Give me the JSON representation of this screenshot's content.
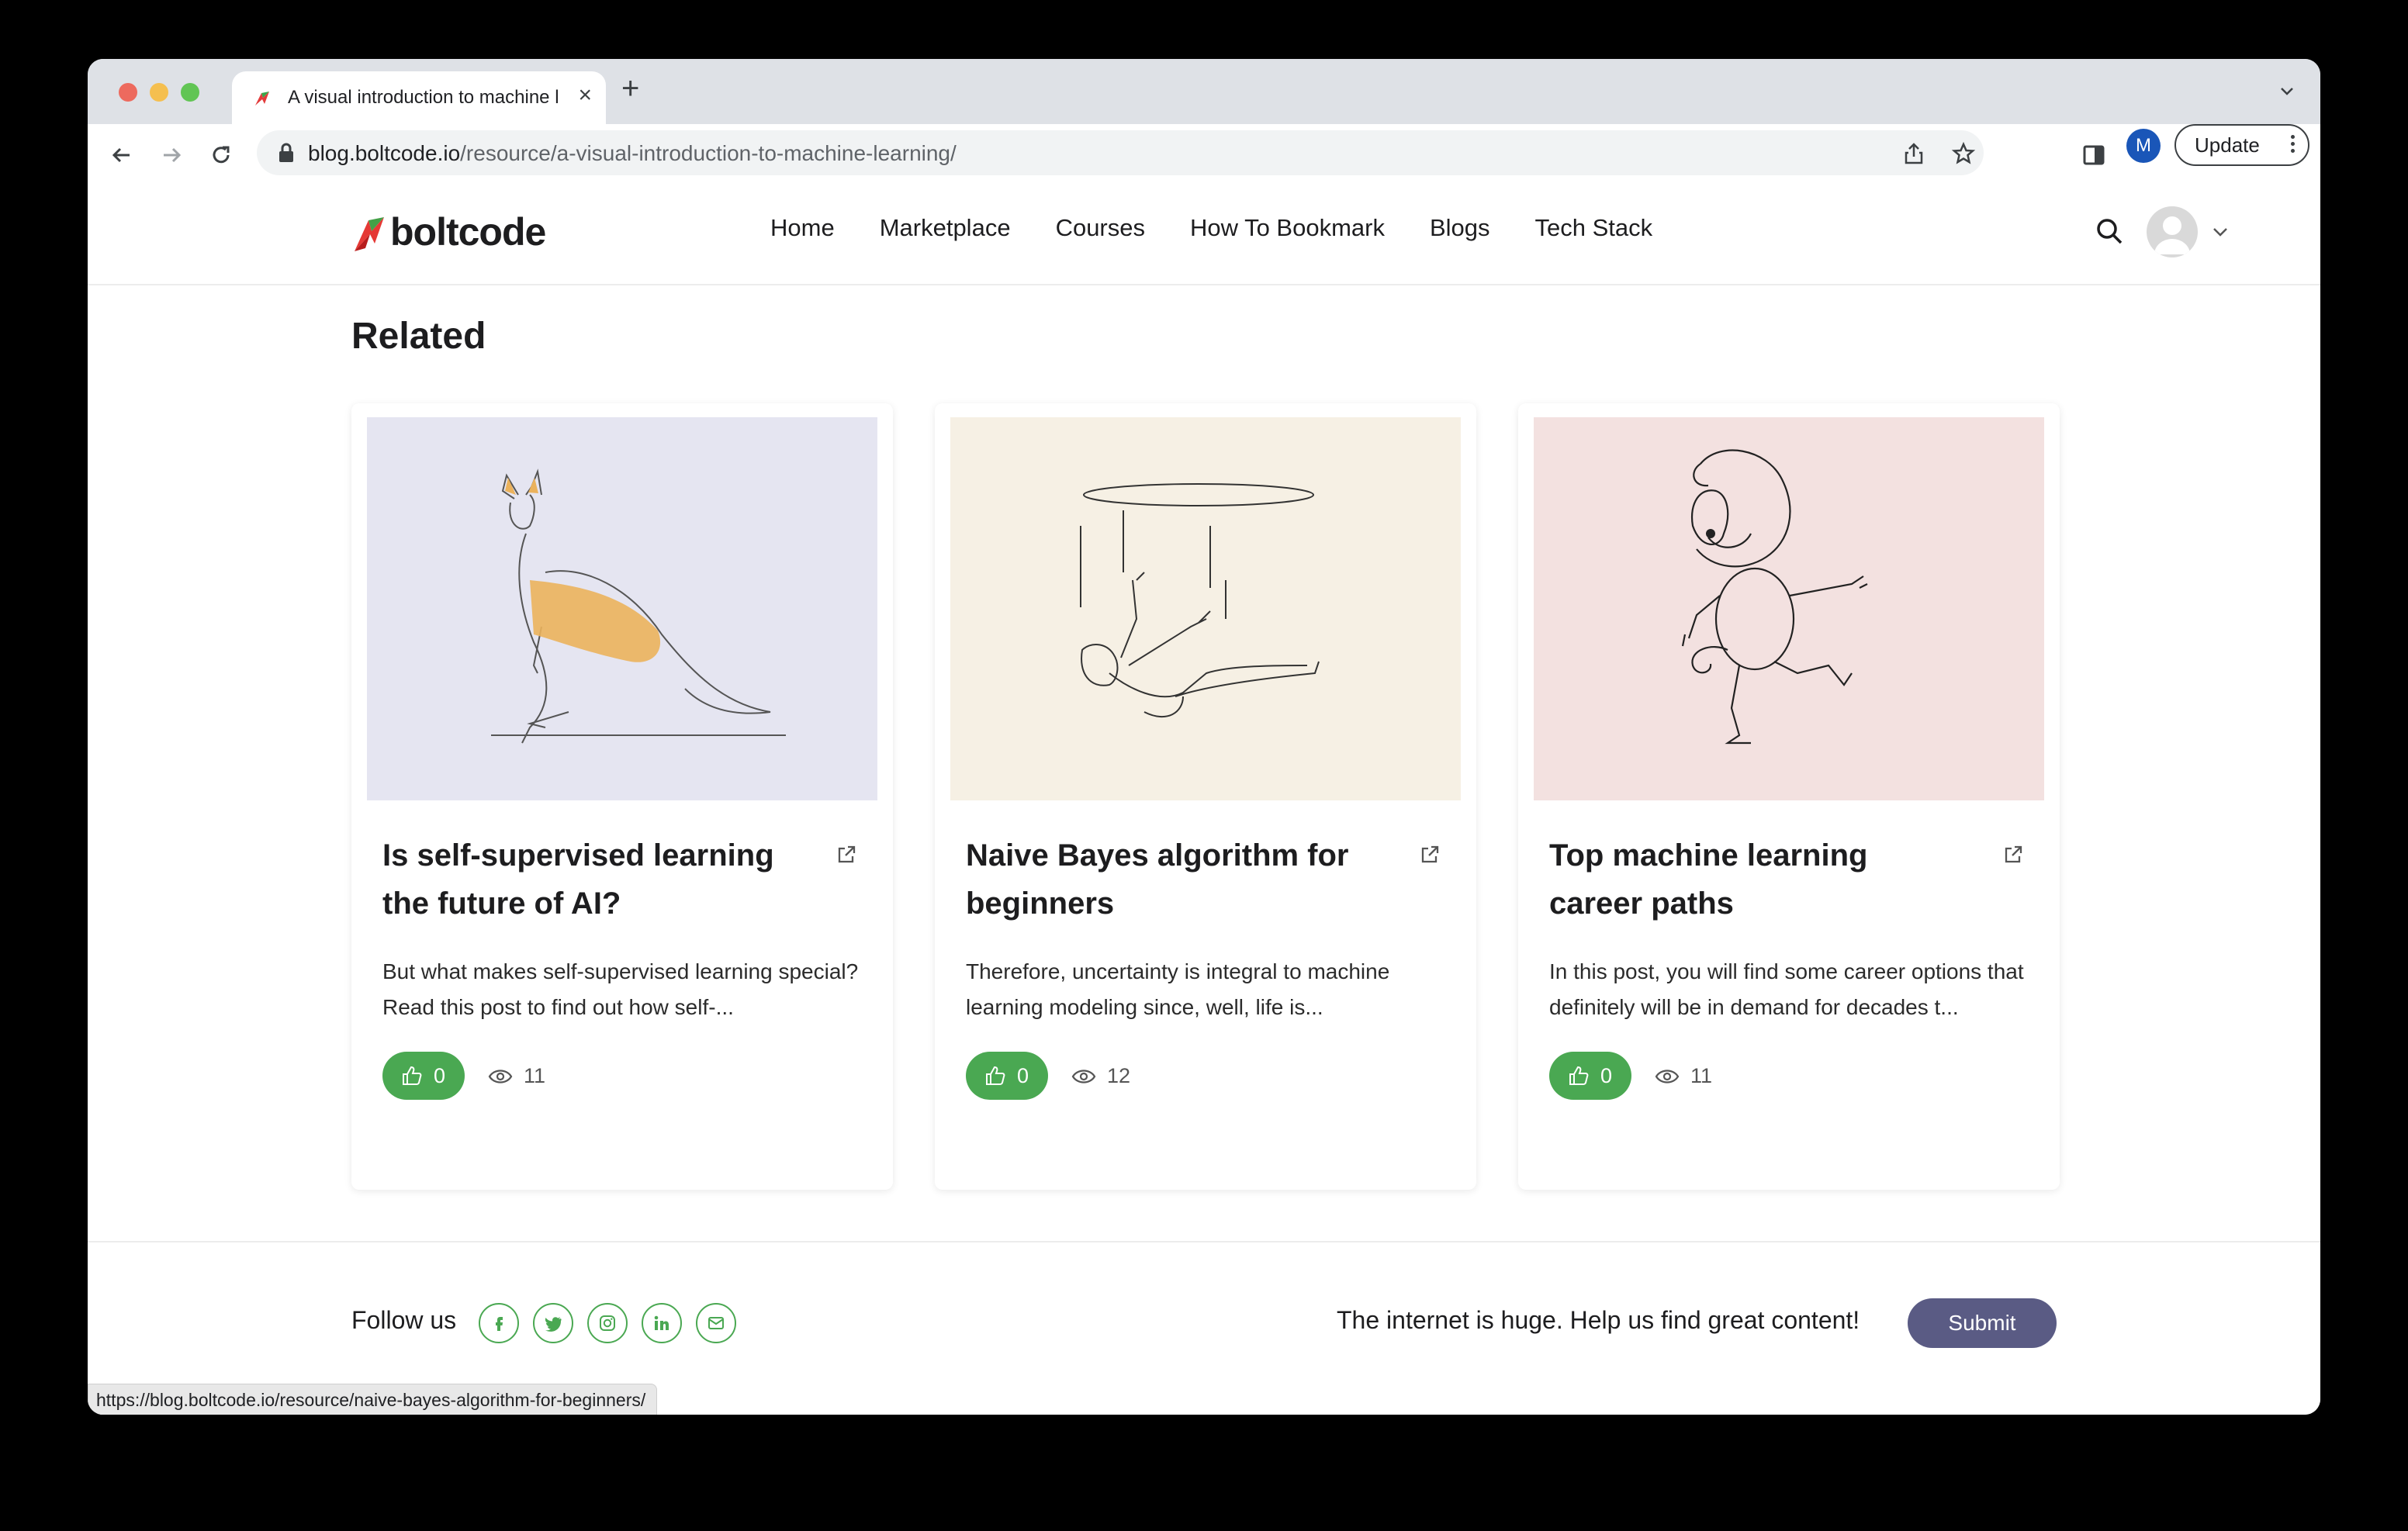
{
  "browser": {
    "tab_title": "A visual introduction to machine learning",
    "url_host": "blog.boltcode.io",
    "url_path": "/resource/a-visual-introduction-to-machine-learning/",
    "profile_initial": "M",
    "update_label": "Update",
    "status_url": "https://blog.boltcode.io/resource/naive-bayes-algorithm-for-beginners/"
  },
  "site": {
    "logo_text": "boltcode",
    "nav": [
      "Home",
      "Marketplace",
      "Courses",
      "How To Bookmark",
      "Blogs",
      "Tech Stack"
    ]
  },
  "related": {
    "heading": "Related",
    "cards": [
      {
        "title": "Is self-supervised learning the future of AI?",
        "description": "But what makes self-supervised learning special? Read this post to find out how self-...",
        "likes": "0",
        "views": "11",
        "image_bg": "#e5e5f1",
        "illustration": "kangaroo"
      },
      {
        "title": "Naive Bayes algorithm for beginners",
        "description": "Therefore, uncertainty is integral to machine learning modeling since, well, life is...",
        "likes": "0",
        "views": "12",
        "image_bg": "#f6f0e4",
        "illustration": "falling-person"
      },
      {
        "title": "Top machine learning career paths",
        "description": "In this post, you will find some career options that definitely will be in demand for decades t...",
        "likes": "0",
        "views": "11",
        "image_bg": "#f3e1e0",
        "illustration": "monkey"
      }
    ]
  },
  "footer": {
    "follow_label": "Follow us",
    "social": [
      "facebook-icon",
      "twitter-icon",
      "instagram-icon",
      "linkedin-icon",
      "email-icon"
    ],
    "cta_text": "The internet is huge. Help us find great content!",
    "submit_label": "Submit"
  },
  "colors": {
    "accent_green": "#4aa852",
    "submit_purple": "#5a5b84"
  }
}
